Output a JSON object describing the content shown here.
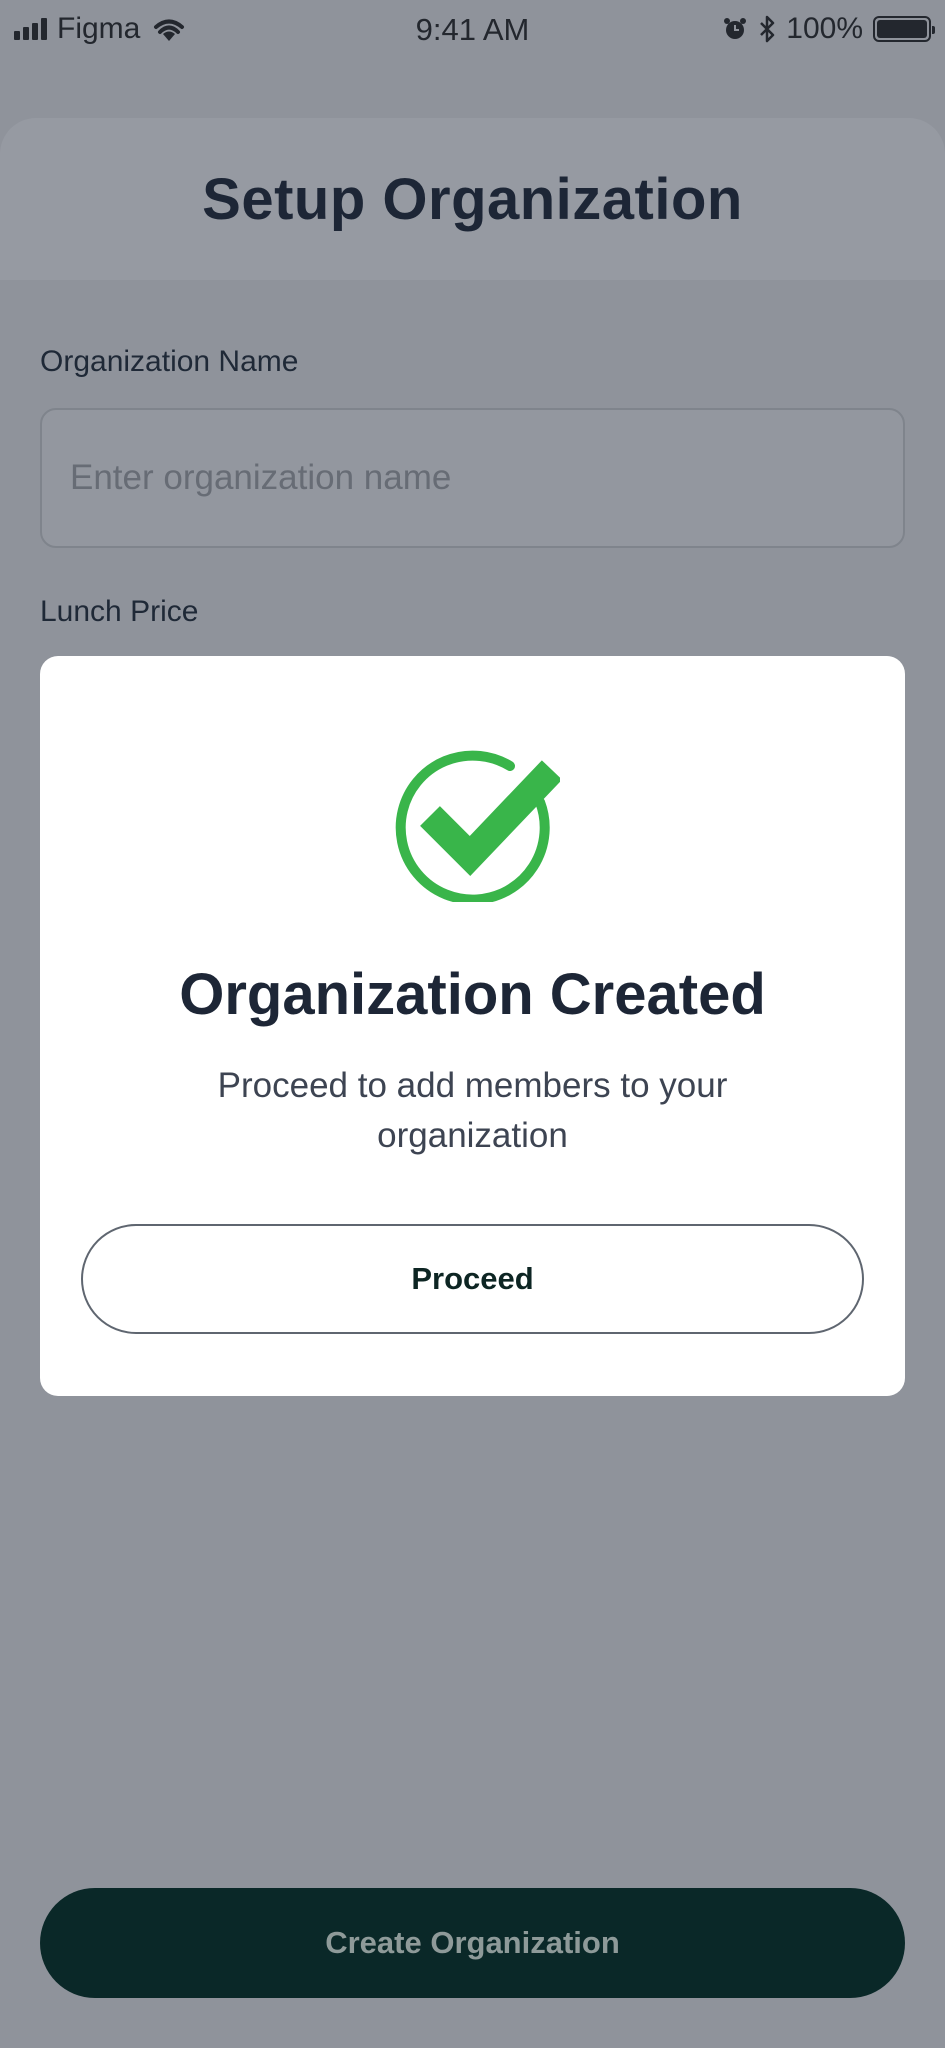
{
  "status_bar": {
    "carrier": "Figma",
    "time": "9:41 AM",
    "battery": "100%"
  },
  "header": {
    "title": "Setup Organization"
  },
  "form": {
    "org_name_label": "Organization Name",
    "org_name_placeholder": "Enter organization name",
    "org_name_value": "",
    "lunch_price_label": "Lunch Price"
  },
  "modal": {
    "icon": "check-circle-icon",
    "title": "Organization Created",
    "subtitle": "Proceed to add members to your organization",
    "proceed_label": "Proceed"
  },
  "footer": {
    "create_label": "Create Organization"
  },
  "colors": {
    "success": "#39b54a",
    "primary_dark": "#0a2828",
    "overlay": "#8f939b"
  }
}
